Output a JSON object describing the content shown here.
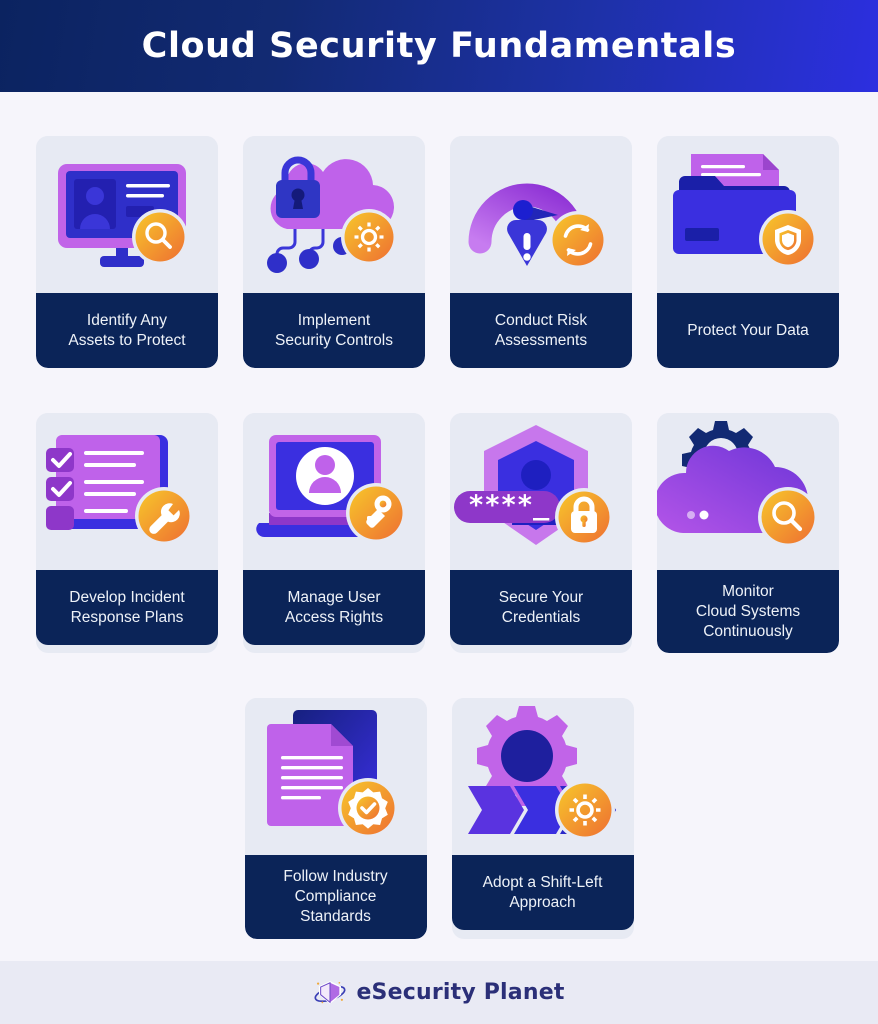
{
  "header": {
    "title": "Cloud Security Fundamentals"
  },
  "colors": {
    "page_background": "#f6f5fb",
    "header_gradient_start": "#0b2360",
    "header_gradient_end": "#2c2fe0",
    "card_art_background": "#e7eaf3",
    "card_label_background": "#0b2458",
    "card_label_text": "#eef2f8",
    "badge_gradient_start": "#f7c72b",
    "badge_gradient_end": "#ee6f32",
    "purple": "#b34ee0",
    "blue": "#3730d9",
    "navy": "#122a73",
    "footer_background": "#e9eaf4",
    "footer_text": "#2b2f78"
  },
  "cards": [
    {
      "id": "identify-assets",
      "label": "Identify Any\nAssets to Protect",
      "label_lines": [
        "Identify Any",
        "Assets to Protect"
      ],
      "art_icon": "monitor-user-icon",
      "badge_icon": "magnifier-icon"
    },
    {
      "id": "implement-security-controls",
      "label": "Implement\nSecurity Controls",
      "label_lines": [
        "Implement",
        "Security Controls"
      ],
      "art_icon": "cloud-lock-icon",
      "badge_icon": "gear-icon"
    },
    {
      "id": "conduct-risk-assessments",
      "label": "Conduct Risk\nAssessments",
      "label_lines": [
        "Conduct Risk",
        "Assessments"
      ],
      "art_icon": "gauge-warning-icon",
      "badge_icon": "refresh-icon"
    },
    {
      "id": "protect-your-data",
      "label": "Protect Your Data",
      "label_lines": [
        "Protect Your Data"
      ],
      "art_icon": "folder-document-icon",
      "badge_icon": "shield-icon"
    },
    {
      "id": "develop-incident-response-plans",
      "label": "Develop Incident\nResponse Plans",
      "label_lines": [
        "Develop Incident",
        "Response Plans"
      ],
      "art_icon": "checklist-icon",
      "badge_icon": "wrench-icon"
    },
    {
      "id": "manage-user-access-rights",
      "label": "Manage User\nAccess Rights",
      "label_lines": [
        "Manage User",
        "Access Rights"
      ],
      "art_icon": "laptop-user-icon",
      "badge_icon": "key-icon"
    },
    {
      "id": "secure-your-credentials",
      "label": "Secure Your\nCredentials",
      "label_lines": [
        "Secure Your",
        "Credentials"
      ],
      "art_icon": "hexagon-shield-password-icon",
      "badge_icon": "padlock-icon",
      "password_mask": "****_"
    },
    {
      "id": "monitor-cloud-systems-continuously",
      "label": "Monitor\nCloud Systems\nContinuously",
      "label_lines": [
        "Monitor",
        "Cloud Systems",
        "Continuously"
      ],
      "art_icon": "cloud-gear-icon",
      "badge_icon": "magnifier-icon"
    },
    {
      "id": "follow-industry-compliance-standards",
      "label": "Follow Industry\nCompliance\nStandards",
      "label_lines": [
        "Follow Industry",
        "Compliance",
        "Standards"
      ],
      "art_icon": "documents-icon",
      "badge_icon": "verified-badge-icon"
    },
    {
      "id": "adopt-a-shift-left-approach",
      "label": "Adopt a Shift-Left\nApproach",
      "label_lines": [
        "Adopt a Shift-Left",
        "Approach"
      ],
      "art_icon": "gear-chevrons-icon",
      "badge_icon": "gear-icon"
    }
  ],
  "footer": {
    "brand": "eSecurity Planet",
    "logo_icon": "shield-planet-logo"
  }
}
